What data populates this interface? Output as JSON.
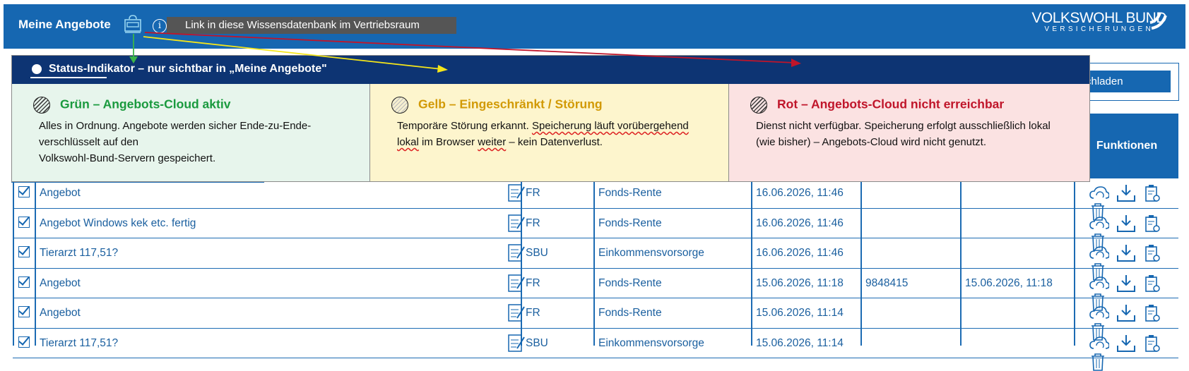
{
  "header": {
    "title": "Meine Angebote",
    "tooltip": "Link in diese Wissensdatenbank im Vertriebsraum",
    "brand_name": "VOLKSWOHL BUND",
    "brand_sub": "VERSICHERUNGEN"
  },
  "download_label": "chladen",
  "functions_header": "Funktionen",
  "status_panel": {
    "heading_prefix": "Status",
    "heading_rest": "-Indikator – nur sichtbar in „Meine Angebote\"",
    "green": {
      "title": "Grün  –  Angebots-Cloud aktiv",
      "line1": "Alles in Ordnung. Angebote werden sicher Ende-zu-Ende-",
      "line2": "verschlüsselt auf den",
      "line3": "Volkswohl-Bund-Servern gespeichert.",
      "color": "#1a9a3e"
    },
    "yellow": {
      "title": "Gelb  –  Eingeschränkt / Störung",
      "line1_a": "Temporäre Störung erkannt. ",
      "line1_b": "Speicherung läuft vorübergehend",
      "line2_a": "lokal",
      "line2_b": " im Browser ",
      "line2_c": "weiter",
      "line2_d": " – kein Datenverlust.",
      "color": "#d29a06"
    },
    "red": {
      "title": "Rot  –  Angebots-Cloud nicht erreichbar",
      "line1": "Dienst nicht verfügbar. Speicherung erfolgt ausschließlich lokal",
      "line2": "(wie bisher) – Angebots-Cloud wird nicht genutzt.",
      "color": "#c0152a"
    }
  },
  "rows": [
    {
      "name": "Angebot",
      "code": "FR",
      "product": "Fonds-Rente",
      "date": "16.06.2026, 11:46",
      "number": "",
      "date2": ""
    },
    {
      "name": "Angebot Windows kek etc. fertig",
      "code": "FR",
      "product": "Fonds-Rente",
      "date": "16.06.2026, 11:46",
      "number": "",
      "date2": ""
    },
    {
      "name": "Tierarzt 117,51?",
      "code": "SBU",
      "product": "Einkommensvorsorge",
      "date": "16.06.2026, 11:46",
      "number": "",
      "date2": ""
    },
    {
      "name": "Angebot",
      "code": "FR",
      "product": "Fonds-Rente",
      "date": "15.06.2026, 11:18",
      "number": "9848415",
      "date2": "15.06.2026, 11:18"
    },
    {
      "name": "Angebot",
      "code": "FR",
      "product": "Fonds-Rente",
      "date": "15.06.2026, 11:14",
      "number": "",
      "date2": ""
    },
    {
      "name": "Tierarzt 117,51?",
      "code": "SBU",
      "product": "Einkommensvorsorge",
      "date": "15.06.2026, 11:14",
      "number": "",
      "date2": ""
    }
  ]
}
